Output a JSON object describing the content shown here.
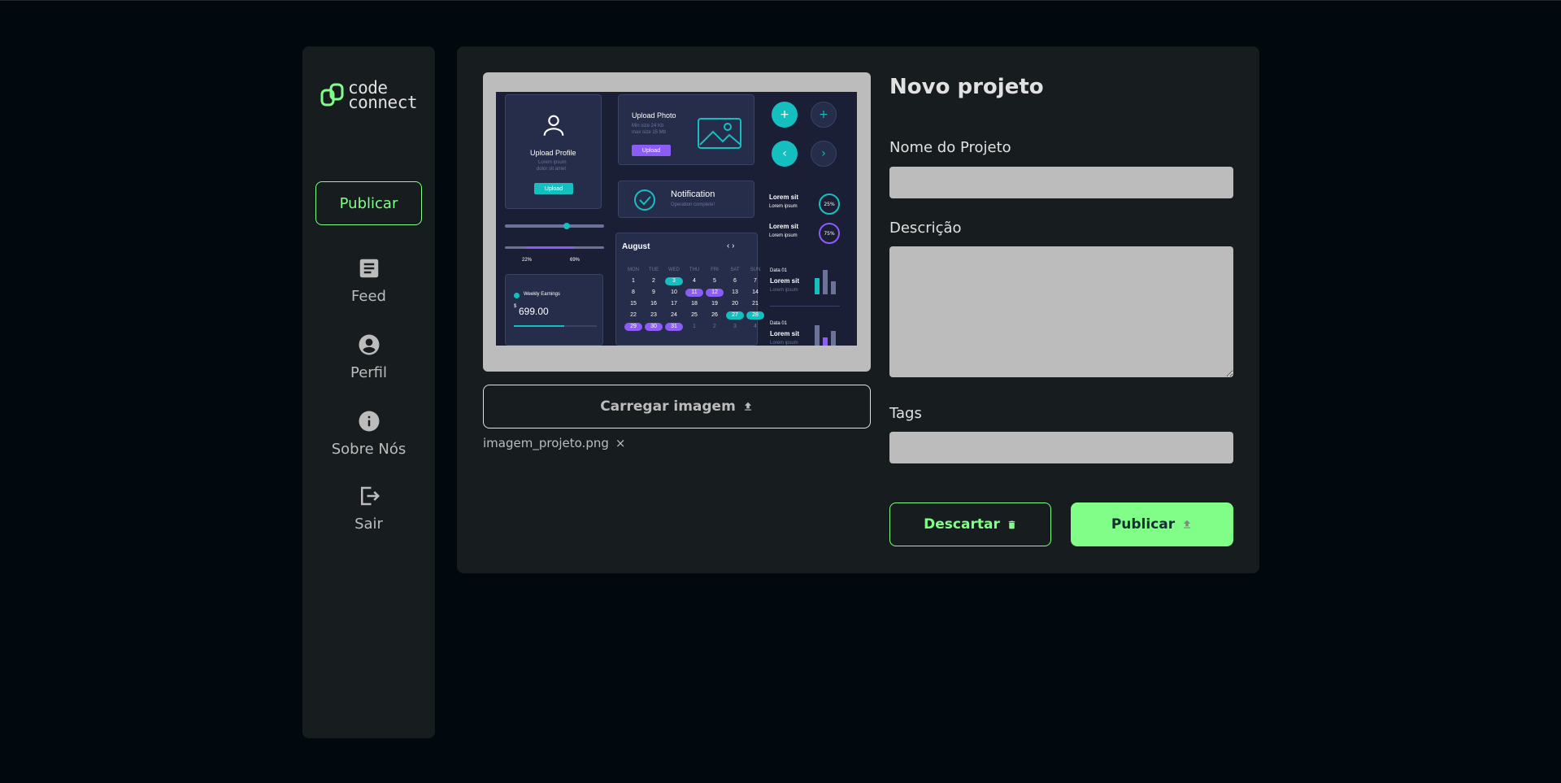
{
  "logo": {
    "line1": "code",
    "line2": "connect"
  },
  "sidebar": {
    "publish_label": "Publicar",
    "items": [
      {
        "label": "Feed",
        "icon": "document-icon"
      },
      {
        "label": "Perfil",
        "icon": "account-circle-icon"
      },
      {
        "label": "Sobre Nós",
        "icon": "info-icon"
      },
      {
        "label": "Sair",
        "icon": "logout-icon"
      }
    ]
  },
  "upload": {
    "button_label": "Carregar imagem",
    "file_name": "imagem_projeto.png",
    "remove_glyph": "×"
  },
  "preview": {
    "upload_profile": {
      "title": "Upload Profile",
      "desc1": "Lorem ipsum",
      "desc2": "dolor sit amet",
      "button": "Upload"
    },
    "upload_photo": {
      "title": "Upload Photo",
      "line1": "Min size 24 Kb",
      "line2": "max size 15 Mb",
      "button": "Upload"
    },
    "notification": {
      "title": "Notification",
      "subtitle": "Operation complete!"
    },
    "slider": {
      "low": "22%",
      "high": "69%"
    },
    "earnings": {
      "label": "Weekly Earnings",
      "currency": "$",
      "amount": "699.00"
    },
    "calendar": {
      "month": "August",
      "days_header": [
        "MON",
        "TUE",
        "WED",
        "THU",
        "FRI",
        "SAT",
        "SUN"
      ],
      "rows": [
        [
          "1",
          "2",
          "3",
          "4",
          "5",
          "6",
          "7"
        ],
        [
          "8",
          "9",
          "10",
          "11",
          "12",
          "13",
          "14"
        ],
        [
          "15",
          "16",
          "17",
          "18",
          "19",
          "20",
          "21"
        ],
        [
          "22",
          "23",
          "24",
          "25",
          "26",
          "27",
          "28"
        ],
        [
          "29",
          "30",
          "31",
          "1",
          "2",
          "3",
          "4"
        ]
      ]
    },
    "stats": [
      {
        "title": "Lorem sit",
        "sub": "Lorem ipsum",
        "value": "25%"
      },
      {
        "title": "Lorem sit",
        "sub": "Lorem ipsum",
        "value": "75%"
      }
    ],
    "bars": [
      {
        "date": "Data 01",
        "title": "Lorem sit",
        "sub": "Lorem ipsum"
      },
      {
        "date": "Data 01",
        "title": "Lorem sit",
        "sub": "Lorem ipsum"
      }
    ]
  },
  "form": {
    "title": "Novo projeto",
    "name_label": "Nome do Projeto",
    "name_value": "",
    "description_label": "Descrição",
    "description_value": "",
    "tags_label": "Tags",
    "tags_value": ""
  },
  "actions": {
    "discard_label": "Descartar",
    "publish_label": "Publicar"
  },
  "colors": {
    "background": "#01080E",
    "panel": "#171D1F",
    "accent": "#81FE88",
    "input": "#BCBCBC"
  }
}
